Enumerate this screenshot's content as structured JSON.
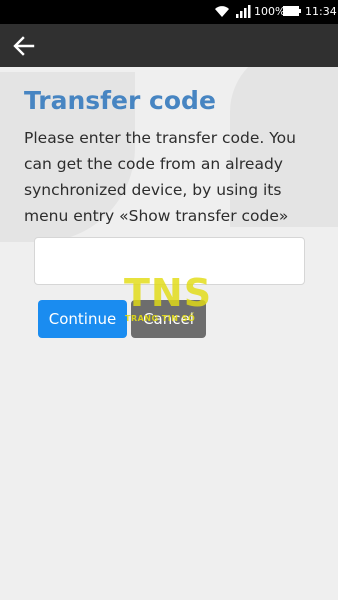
{
  "status_bar": {
    "battery_percent": "100%",
    "time": "11:34",
    "icons": [
      "wifi-icon",
      "signal-icon",
      "battery-icon"
    ]
  },
  "app_bar": {
    "back_icon": "arrow-left-icon"
  },
  "main": {
    "title": "Transfer code",
    "instructions": "Please enter the transfer code. You can get the code from an already synchronized device, by using its menu entry «Show transfer code»",
    "code_input": {
      "value": "",
      "placeholder": ""
    },
    "continue_label": "Continue",
    "cancel_label": "Cancel"
  },
  "watermark": {
    "letters": "TNS",
    "subtext": "TRANG TIN SỐ"
  },
  "colors": {
    "title": "#4785c2",
    "continue_button": "#1a8cf0",
    "cancel_button": "#6d6d6d",
    "app_bar": "#303030",
    "background": "#efefef"
  }
}
